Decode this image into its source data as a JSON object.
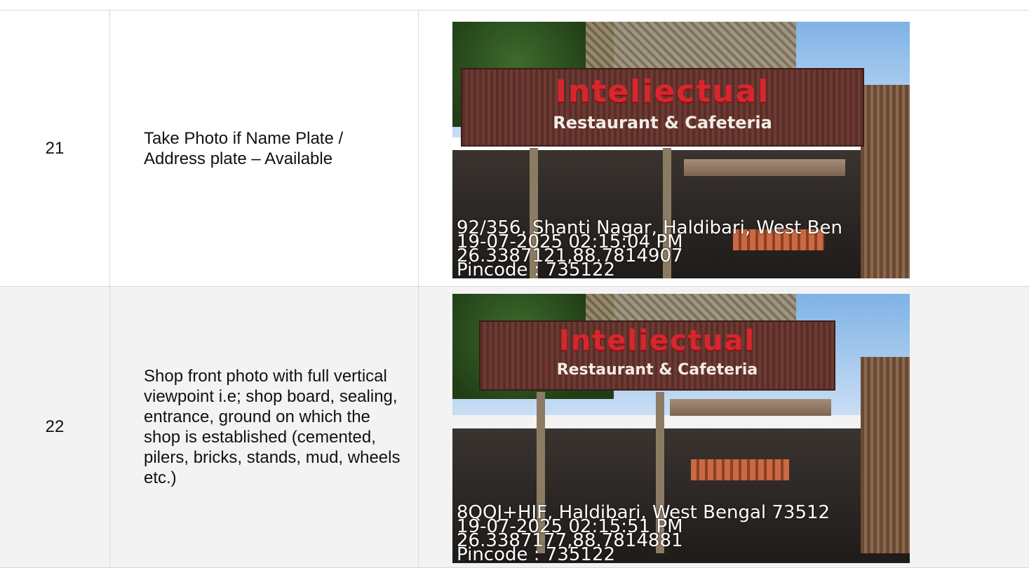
{
  "rows": [
    {
      "number": "21",
      "description": "Take Photo if Name Plate / Address plate – Available",
      "photo": {
        "sign_title": "Inteliectual",
        "sign_subtitle": "Restaurant & Cafeteria",
        "overlay": [
          "92/356, Shanti Nagar, Haldibari, West Ben",
          "19-07-2025 02:15:04 PM",
          "26.3387121,88.7814907",
          "Pincode : 735122"
        ]
      }
    },
    {
      "number": "22",
      "description": "Shop front photo with full vertical viewpoint i.e; shop board, sealing, entrance, ground on which the shop is established (cemented, pilers, bricks, stands, mud, wheels etc.)",
      "photo": {
        "sign_title": "Inteliectual",
        "sign_subtitle": "Restaurant & Cafeteria",
        "overlay": [
          "8QQJ+HJF, Haldibari, West Bengal 73512",
          "19-07-2025 02:15:51 PM",
          "26.3387177,88.7814881",
          "Pincode : 735122"
        ]
      }
    }
  ]
}
